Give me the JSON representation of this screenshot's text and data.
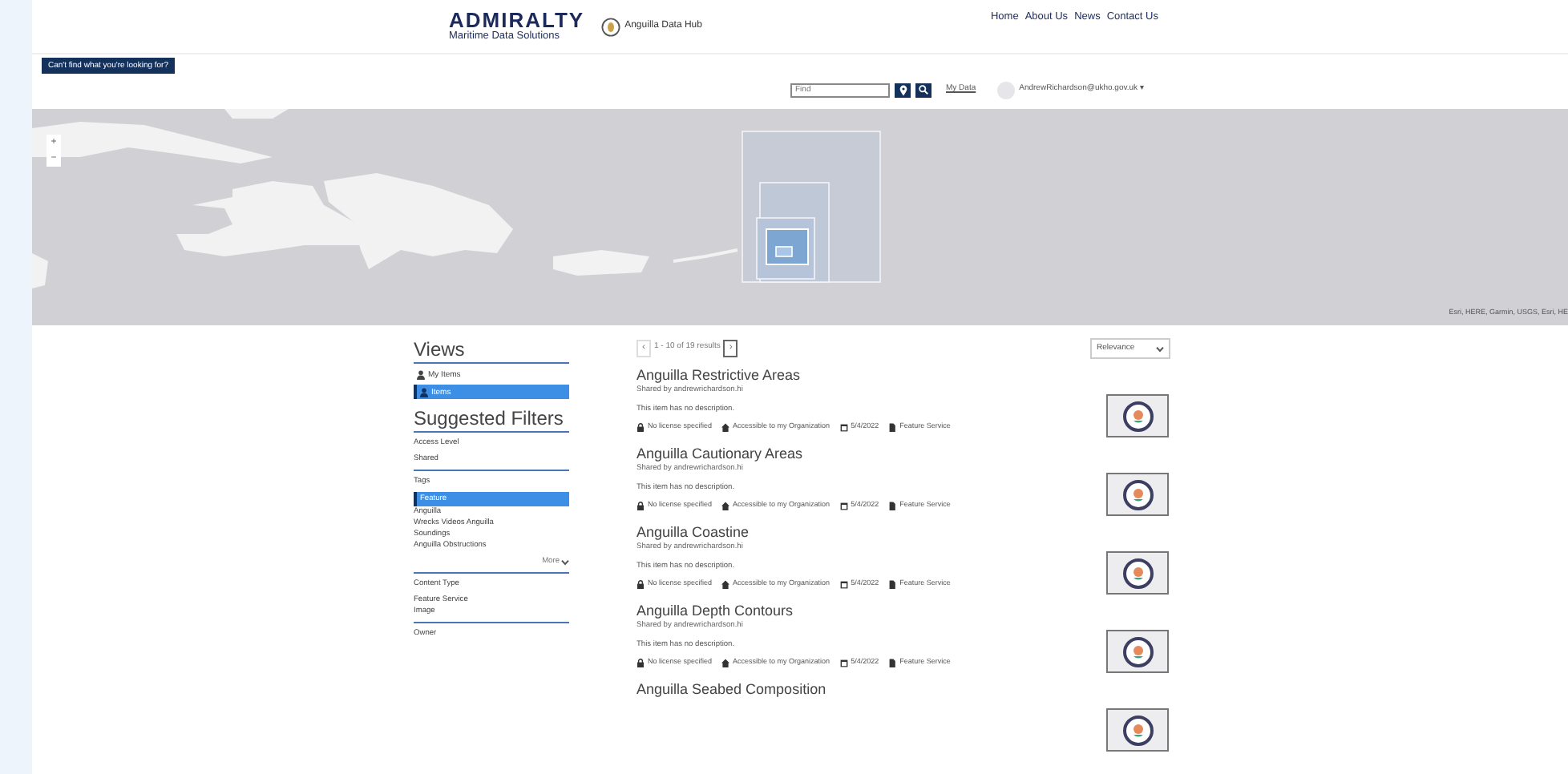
{
  "header": {
    "logo_title": "ADMIRALTY",
    "logo_subtitle": "Maritime Data Solutions",
    "site_name": "Anguilla Data Hub",
    "nav": [
      "Home",
      "About Us",
      "News",
      "Contact Us"
    ]
  },
  "help_button": "Can't find what you're looking for?",
  "search": {
    "placeholder": "Find",
    "my_data": "My Data",
    "user": "AndrewRichardson@ukho.gov.uk",
    "user_caret": "▾"
  },
  "map": {
    "zoom_in": "+",
    "zoom_out": "−",
    "attribution": "Esri, HERE, Garmin, USGS, Esri, HE"
  },
  "sidebar": {
    "views_title": "Views",
    "views": [
      {
        "label": "My Items",
        "selected": false
      },
      {
        "label": "Items",
        "selected": true
      }
    ],
    "filters_title": "Suggested Filters",
    "filter_groups": [
      {
        "title": "Access Level",
        "options": [
          {
            "label": "Shared",
            "selected": false
          }
        ]
      },
      {
        "title": "Tags",
        "options": [
          {
            "label": "Feature",
            "selected": true
          },
          {
            "label": "Anguilla",
            "selected": false
          },
          {
            "label": "Wrecks Videos Anguilla",
            "selected": false
          },
          {
            "label": "Soundings",
            "selected": false
          },
          {
            "label": "Anguilla Obstructions",
            "selected": false
          }
        ],
        "more": "More"
      },
      {
        "title": "Content Type",
        "options": [
          {
            "label": "Feature Service",
            "selected": false
          },
          {
            "label": "Image",
            "selected": false
          }
        ]
      },
      {
        "title": "Owner"
      }
    ]
  },
  "pagination": {
    "prev": "‹",
    "summary": "1 - 10 of 19 results",
    "next": "›"
  },
  "sort": {
    "value": "Relevance"
  },
  "results": [
    {
      "title": "Anguilla Restrictive Areas",
      "shared_by": "Shared by andrewrichardson.hi",
      "description": "This item has no description.",
      "license": "No license specified",
      "access": "Accessible to my Organization",
      "date": "5/4/2022",
      "type": "Feature Service"
    },
    {
      "title": "Anguilla Cautionary Areas",
      "shared_by": "Shared by andrewrichardson.hi",
      "description": "This item has no description.",
      "license": "No license specified",
      "access": "Accessible to my Organization",
      "date": "5/4/2022",
      "type": "Feature Service"
    },
    {
      "title": "Anguilla Coastine",
      "shared_by": "Shared by andrewrichardson.hi",
      "description": "This item has no description.",
      "license": "No license specified",
      "access": "Accessible to my Organization",
      "date": "5/4/2022",
      "type": "Feature Service"
    },
    {
      "title": "Anguilla Depth Contours",
      "shared_by": "Shared by andrewrichardson.hi",
      "description": "This item has no description.",
      "license": "No license specified",
      "access": "Accessible to my Organization",
      "date": "5/4/2022",
      "type": "Feature Service"
    },
    {
      "title": "Anguilla Seabed Composition"
    }
  ]
}
